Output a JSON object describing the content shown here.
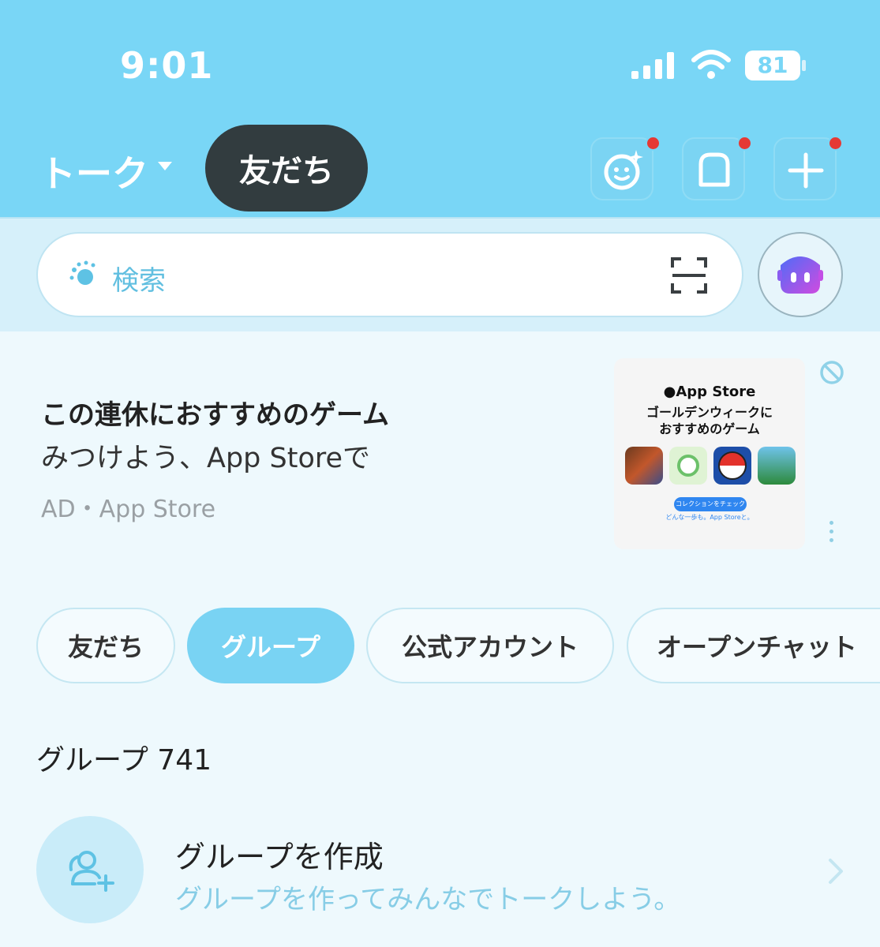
{
  "status_bar": {
    "time": "9:01",
    "battery": "81"
  },
  "header": {
    "talk_label": "トーク",
    "friends_label": "友だち",
    "buttons": [
      "face-sparkle-icon",
      "square-bubble-icon",
      "plus-icon"
    ]
  },
  "search": {
    "placeholder": "検索"
  },
  "ad": {
    "title": "この連休におすすめのゲーム",
    "subtitle": "みつけよう、App Storeで",
    "source": "AD・App Store",
    "image": {
      "store": "App Store",
      "headline_1": "ゴールデンウィークに",
      "headline_2": "おすすめのゲーム",
      "cta": "コレクションをチェック",
      "tagline": "どんな一歩も。App Storeと。"
    }
  },
  "filter_tabs": [
    {
      "label": "友だち",
      "active": false
    },
    {
      "label": "グループ",
      "active": true
    },
    {
      "label": "公式アカウント",
      "active": false
    },
    {
      "label": "オープンチャット",
      "active": false
    }
  ],
  "group_count": "グループ 741",
  "create_group": {
    "title": "グループを作成",
    "subtitle": "グループを作ってみんなでトークしよう。"
  },
  "colors": {
    "header": "#79d6f6",
    "accent": "#79d3f3",
    "dark_pill": "#323c3f",
    "notif_dot": "#e53935"
  }
}
